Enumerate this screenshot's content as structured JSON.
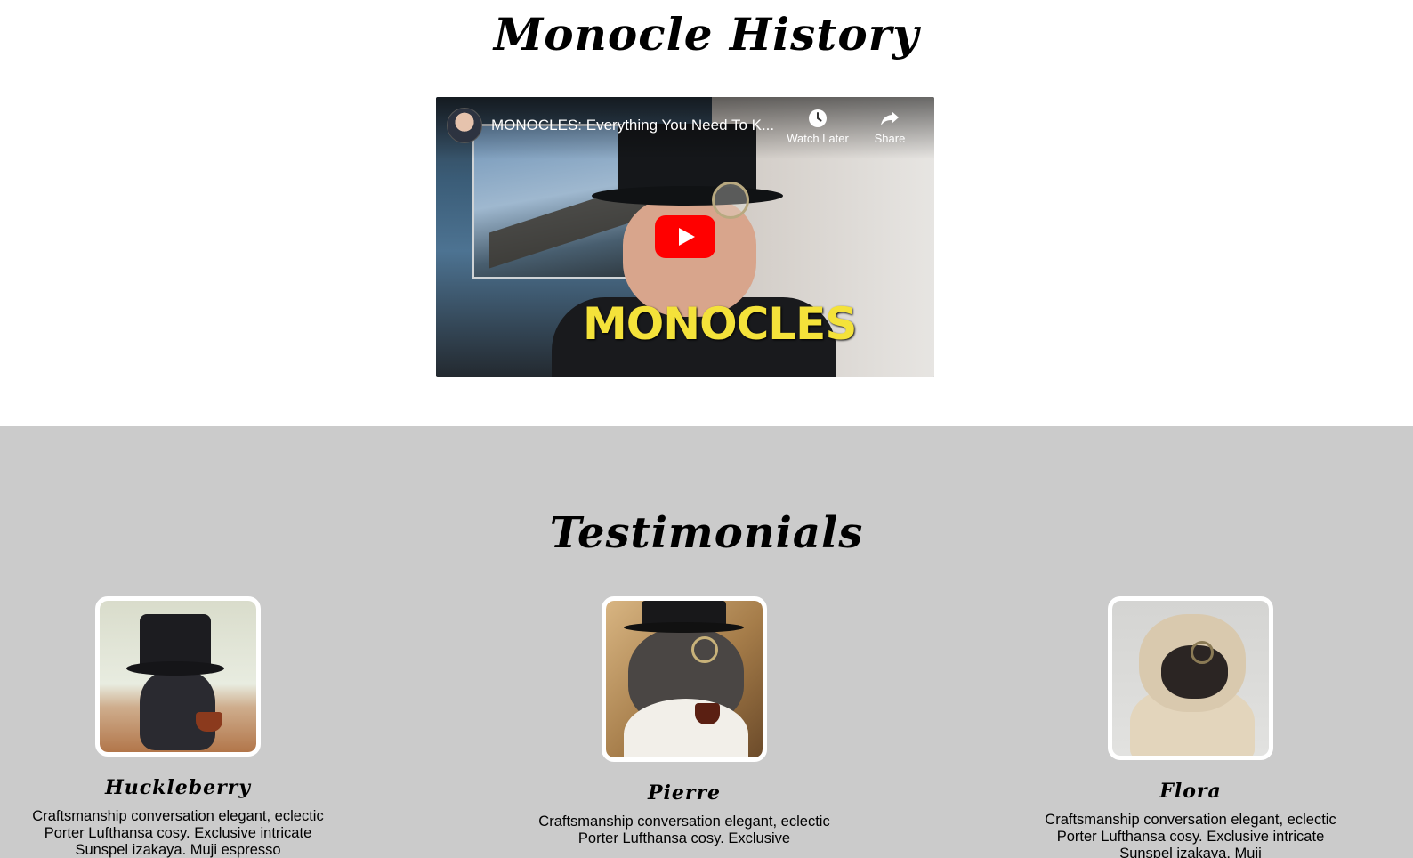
{
  "history": {
    "heading": "Monocle History",
    "video": {
      "title": "MONOCLES: Everything You Need To K...",
      "watch_later_label": "Watch Later",
      "share_label": "Share",
      "caption": "MONOCLES"
    }
  },
  "testimonials": {
    "heading": "Testimonials",
    "cards": [
      {
        "name": "Huckleberry",
        "text": "Craftsmanship conversation elegant, eclectic Porter Lufthansa cosy. Exclusive intricate Sunspel izakaya. Muji espresso"
      },
      {
        "name": "Pierre",
        "text": "Craftsmanship conversation elegant, eclectic Porter Lufthansa cosy. Exclusive"
      },
      {
        "name": "Flora",
        "text": "Craftsmanship conversation elegant, eclectic Porter Lufthansa cosy. Exclusive intricate Sunspel izakaya. Muji"
      }
    ]
  },
  "colors": {
    "testimonials_background": "#cbcbcb",
    "play_button": "#ff0000",
    "caption": "#f4e23a"
  },
  "icons": {
    "watch_later": "clock-icon",
    "share": "share-arrow-icon",
    "play": "youtube-play-icon"
  }
}
